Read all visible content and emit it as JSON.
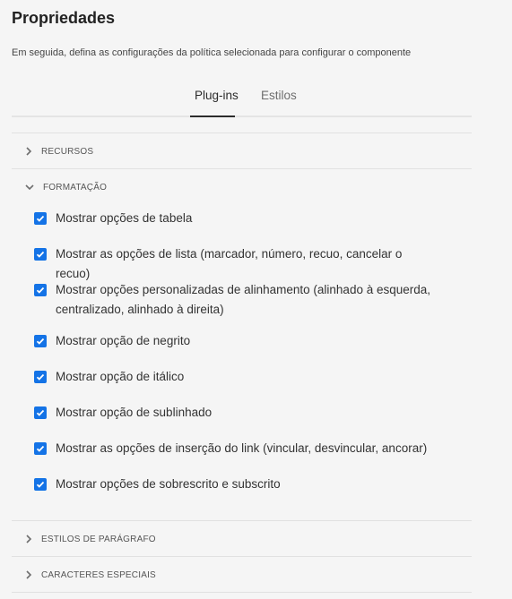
{
  "header": {
    "title": "Propriedades",
    "subtitle": "Em seguida, defina as configurações da política selecionada para configurar o componente"
  },
  "tabs": [
    {
      "label": "Plug-ins",
      "selected": true
    },
    {
      "label": "Estilos",
      "selected": false
    }
  ],
  "sections": [
    {
      "label": "RECURSOS",
      "expanded": false
    },
    {
      "label": "FORMATAÇÃO",
      "expanded": true,
      "options": [
        {
          "label": "Mostrar opções de tabela",
          "checked": true
        },
        {
          "label": "Mostrar as opções de lista (marcador, número, recuo, cancelar o recuo)",
          "checked": true
        },
        {
          "label": "Mostrar opções personalizadas de alinhamento (alinhado à esquerda, centralizado, alinhado à direita)",
          "checked": true
        },
        {
          "label": "Mostrar opção de negrito",
          "checked": true
        },
        {
          "label": "Mostrar opção de itálico",
          "checked": true
        },
        {
          "label": "Mostrar opção de sublinhado",
          "checked": true
        },
        {
          "label": "Mostrar as opções de inserção do link (vincular, desvincular, ancorar)",
          "checked": true
        },
        {
          "label": "Mostrar opções de sobrescrito e subscrito",
          "checked": true
        }
      ]
    },
    {
      "label": "ESTILOS DE PARÁGRAFO",
      "expanded": false
    },
    {
      "label": "CARACTERES ESPECIAIS",
      "expanded": false
    }
  ],
  "colors": {
    "accent": "#1473e6",
    "background": "#f5f5f5"
  }
}
